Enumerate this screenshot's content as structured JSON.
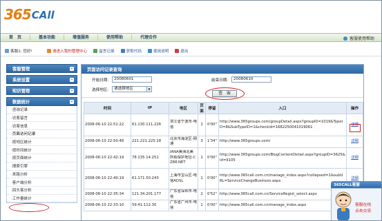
{
  "logo": {
    "num": "365",
    "text": "CAll"
  },
  "mainnav": {
    "items": [
      "首　页",
      "基本功能",
      "增值服务",
      "使用帮助",
      "代理合作"
    ],
    "help": "客服使用帮助"
  },
  "subnav": {
    "greeting": "客服1: 您好!",
    "links": [
      "请进入我的管理中心",
      "留言记录",
      "获取代码",
      "使用说明",
      "退出"
    ]
  },
  "sidebar": {
    "groups": [
      "客服管理",
      "系统设置",
      "知识管理",
      "数据统计"
    ],
    "items": [
      "·咨询记录",
      "·访客留言",
      "·访客信息",
      "·页面访问记录",
      "·按地区统计",
      "·按时间统计",
      "·按页面统计",
      "·搜索引擎",
      "·来路分析",
      "·客户端分析",
      "·回头客分析",
      "·工作量统计"
    ]
  },
  "content": {
    "title": "页面访问记录查询",
    "start_label": "开始日期:",
    "start_value": "20080601",
    "end_label": "结束日期:",
    "end_value": "20080610",
    "region_label": "选择地区:",
    "region_value": "请选择地区",
    "query_button": "查　询"
  },
  "table": {
    "headers": [
      "时间",
      "IP",
      "地区",
      "页面",
      "停留",
      "入口",
      "操作"
    ],
    "rows": [
      {
        "time": "2008-06-10 22:51:22",
        "ip": "61.130.111.226",
        "region": "浙江省宁波市-电信",
        "page": "1",
        "stay": "0'00\"",
        "entry": "http://www.365groups.com/groupDetail.aspx?groupID=1019&TypeID=8&SubTypeID=1&checkid=1682250041019061",
        "op": "详细"
      },
      {
        "time": "2008-06-10 22:50:48",
        "ip": "221.221.225.18",
        "region": "北京市海淀区-网通",
        "page": "3",
        "stay": "1'34\"",
        "entry": "http://www.365groups.com/",
        "op": "详细"
      },
      {
        "time": "2008-06-10 22:42:19",
        "ip": "78.135.14.251",
        "region": "IANA美洲北美所有保护地址-CZ88.NET",
        "page": "1",
        "stay": "0'00\"",
        "entry": "http://www.365groups.com/BlogContentDetail.aspx?groupID=3625&id=9105",
        "op": "详细"
      },
      {
        "time": "2008-06-10 22:40:19",
        "ip": "61.171.50.243",
        "region": "上海市宝山区-电信ADSL",
        "page": "1",
        "stay": "0'00\"",
        "entry": "http://www.365call.com.cn/manage_index.aspx?collapsed=1&subURL=ServiceChangeBusiness.aspx",
        "op": "详细"
      },
      {
        "time": "2008-06-10 22:35:34",
        "ip": "121.34.201.177",
        "region": "广东省深圳市-电信",
        "page": "2",
        "stay": "0'52\"",
        "entry": "http://www.365call.com.cn/ServiceRegist_select.aspx",
        "op": "详细"
      },
      {
        "time": "2008-06-10 22:33:10",
        "ip": "59.41.112.30",
        "region": "广东省广州市-电信",
        "page": "1",
        "stay": "0'00\"",
        "entry": "http://www.365call.com.cn/manage_index.aspx",
        "op": "详细"
      }
    ]
  },
  "mascot": {
    "header": "365CALL客服",
    "line1": "客服在线",
    "line2": "点击交流"
  }
}
